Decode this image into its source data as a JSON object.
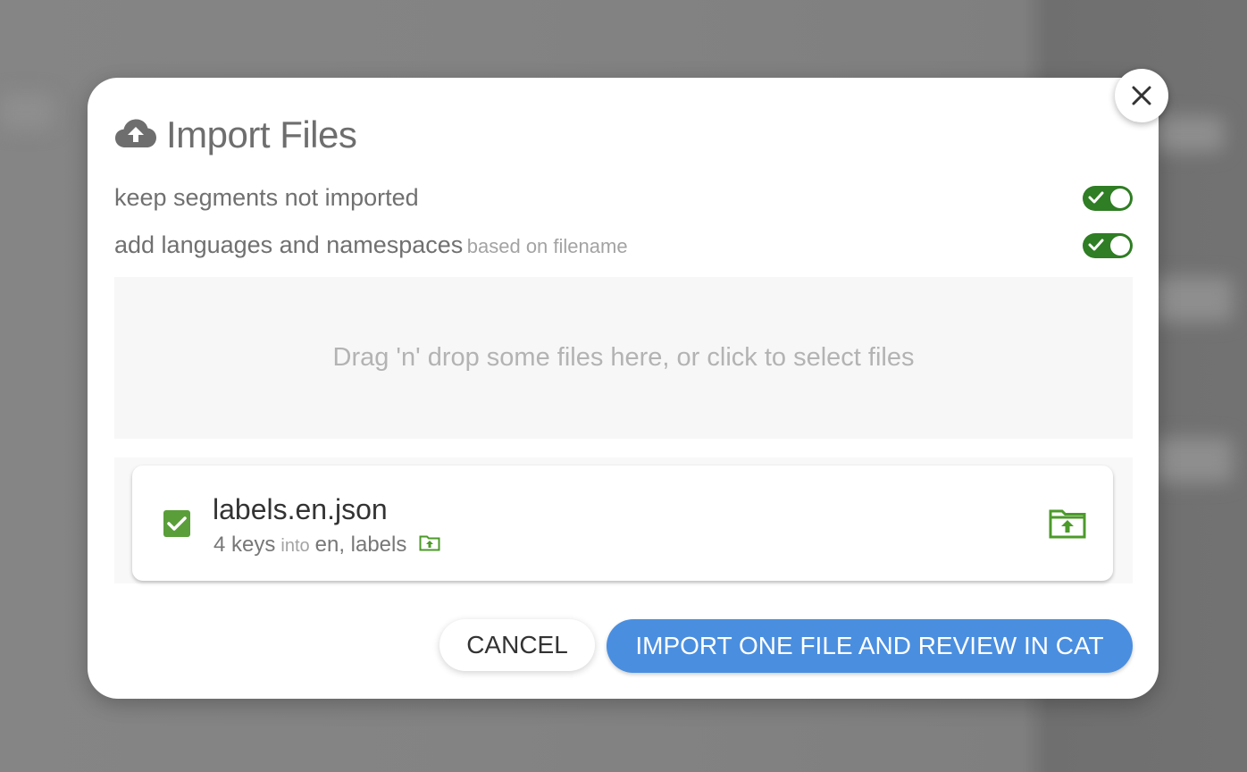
{
  "dialog": {
    "title": "Import Files",
    "title_icon": "cloud-upload-icon",
    "close_icon": "close-icon"
  },
  "options": [
    {
      "label": "keep segments not imported",
      "hint": "",
      "enabled": true
    },
    {
      "label": "add languages and namespaces",
      "hint": "based on filename",
      "enabled": true
    }
  ],
  "dropzone": {
    "text": "Drag 'n' drop some files here, or click to select files"
  },
  "files": [
    {
      "name": "labels.en.json",
      "checked": true,
      "keys": "4 keys",
      "into": "into",
      "target": "en, labels",
      "icon": "folder-upload-icon"
    }
  ],
  "actions": {
    "cancel_label": "CANCEL",
    "import_label": "IMPORT ONE FILE AND REVIEW IN CAT"
  },
  "colors": {
    "toggle_on": "#2f7d24",
    "checkbox": "#5a9e3a",
    "folder_icon": "#4c9a2a",
    "primary_button": "#4a8ee0"
  }
}
